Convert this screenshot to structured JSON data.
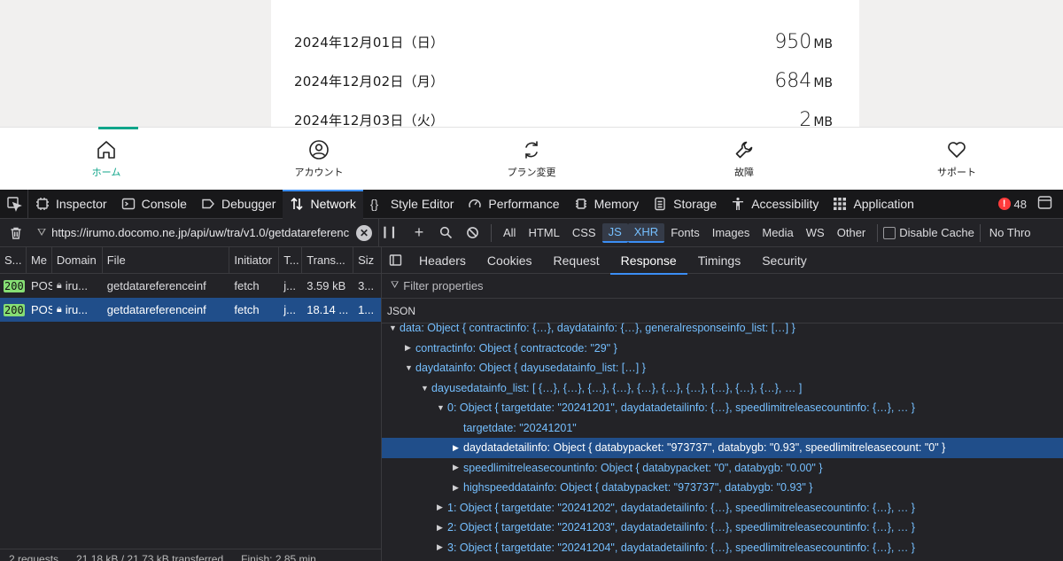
{
  "webpage": {
    "usage_rows": [
      {
        "date": "2024年12月01日（日）",
        "value": "950",
        "unit": "MB"
      },
      {
        "date": "2024年12月02日（月）",
        "value": "684",
        "unit": "MB"
      },
      {
        "date": "2024年12月03日（火）",
        "value": "2",
        "unit": "MB"
      }
    ],
    "nav": {
      "home": "ホーム",
      "account": "アカウント",
      "plan": "プラン変更",
      "trouble": "故障",
      "support": "サポート"
    },
    "accent_color": "#10a58a"
  },
  "devtools": {
    "tabs": {
      "inspector": "Inspector",
      "console": "Console",
      "debugger": "Debugger",
      "network": "Network",
      "style_editor": "Style Editor",
      "performance": "Performance",
      "memory": "Memory",
      "storage": "Storage",
      "accessibility": "Accessibility",
      "application": "Application"
    },
    "error_count": "48",
    "toolbar": {
      "url_filter": "https://irumo.docomo.ne.jp/api/uw/tra/v1.0/getdatareferenceinf",
      "types": {
        "all": "All",
        "html": "HTML",
        "css": "CSS",
        "js": "JS",
        "xhr": "XHR",
        "fonts": "Fonts",
        "images": "Images",
        "media": "Media",
        "ws": "WS",
        "other": "Other"
      },
      "disable_cache": "Disable Cache",
      "throttle": "No Thro"
    },
    "request_table": {
      "headers": {
        "status": "S...",
        "method": "Me",
        "domain": "Domain",
        "file": "File",
        "initiator": "Initiator",
        "type": "T...",
        "transferred": "Trans...",
        "size": "Siz"
      },
      "rows": [
        {
          "status": "200",
          "method": "POS",
          "domain": "iru...",
          "file": "getdatareferenceinf",
          "initiator": "fetch",
          "type": "j...",
          "transferred": "3.59 kB",
          "size": "3..."
        },
        {
          "status": "200",
          "method": "POS",
          "domain": "iru...",
          "file": "getdatareferenceinf",
          "initiator": "fetch",
          "type": "j...",
          "transferred": "18.14 ...",
          "size": "1..."
        }
      ],
      "footer": {
        "requests": "2 requests",
        "transferred": "21.18 kB / 21.73 kB transferred",
        "finish": "Finish: 2.85 min"
      }
    },
    "details": {
      "tabs": {
        "headers": "Headers",
        "cookies": "Cookies",
        "request": "Request",
        "response": "Response",
        "timings": "Timings",
        "security": "Security"
      },
      "filter_placeholder": "Filter properties",
      "json_label": "JSON",
      "tree": [
        {
          "text": "data: Object { contractinfo: {…}, daydatainfo: {…}, generalresponseinfo_list: […] }",
          "twisty": "▼"
        },
        {
          "text": "contractinfo: Object { contractcode: \"29\" }",
          "twisty": "▶"
        },
        {
          "text": "daydatainfo: Object { dayusedatainfo_list: […] }",
          "twisty": "▼"
        },
        {
          "text": "dayusedatainfo_list: [ {…}, {…}, {…}, {…}, {…}, {…}, {…}, {…}, {…}, {…}, … ]",
          "twisty": "▼"
        },
        {
          "text": "0: Object { targetdate: \"20241201\", daydatadetailinfo: {…}, speedlimitreleasecountinfo: {…}, … }",
          "twisty": "▼"
        },
        {
          "text": "targetdate: \"20241201\"",
          "twisty": ""
        },
        {
          "text": "daydatadetailinfo: Object { databypacket: \"973737\", databygb: \"0.93\", speedlimitreleasecount: \"0\" }",
          "twisty": "▶"
        },
        {
          "text": "speedlimitreleasecountinfo: Object { databypacket: \"0\", databygb: \"0.00\" }",
          "twisty": "▶"
        },
        {
          "text": "highspeeddatainfo: Object { databypacket: \"973737\", databygb: \"0.93\" }",
          "twisty": "▶"
        },
        {
          "text": "1: Object { targetdate: \"20241202\", daydatadetailinfo: {…}, speedlimitreleasecountinfo: {…}, … }",
          "twisty": "▶"
        },
        {
          "text": "2: Object { targetdate: \"20241203\", daydatadetailinfo: {…}, speedlimitreleasecountinfo: {…}, … }",
          "twisty": "▶"
        },
        {
          "text": "3: Object { targetdate: \"20241204\", daydatadetailinfo: {…}, speedlimitreleasecountinfo: {…}, … }",
          "twisty": "▶"
        }
      ]
    }
  }
}
